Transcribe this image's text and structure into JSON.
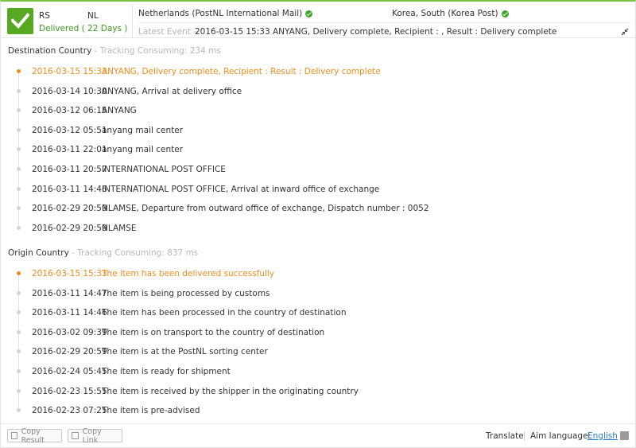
{
  "header": {
    "from_code": "RS",
    "to_code": "NL",
    "status": "Delivered ( 22 Days )",
    "from_carrier": "Netherlands (PostNL International Mail)",
    "to_carrier": "Korea, South (Korea Post)",
    "latest_label": "Latest Event --",
    "latest_text": "2016-03-15 15:33 ANYANG, Delivery complete, Recipient :               , Result : Delivery complete",
    "status_color": "#57a822",
    "icons": [
      "check-icon",
      "check-circle-icon",
      "collapse-icon"
    ]
  },
  "destination": {
    "title": "Destination Country",
    "consuming": " - Tracking Consuming: 234 ms",
    "events": [
      {
        "time": "2016-03-15 15:33",
        "desc": "ANYANG, Delivery complete, Recipient :               Result : Delivery complete"
      },
      {
        "time": "2016-03-14 10:30",
        "desc": "ANYANG, Arrival at delivery office"
      },
      {
        "time": "2016-03-12 06:15",
        "desc": "ANYANG"
      },
      {
        "time": "2016-03-12 05:51",
        "desc": "anyang mail center"
      },
      {
        "time": "2016-03-11 22:01",
        "desc": "anyang mail center"
      },
      {
        "time": "2016-03-11 20:57",
        "desc": "INTERNATIONAL POST OFFICE"
      },
      {
        "time": "2016-03-11 14:46",
        "desc": "INTERNATIONAL POST OFFICE, Arrival at inward office of exchange"
      },
      {
        "time": "2016-02-29 20:59",
        "desc": "NLAMSE, Departure from outward office of exchange, Dispatch number : 0052"
      },
      {
        "time": "2016-02-29 20:59",
        "desc": "NLAMSE"
      }
    ]
  },
  "origin": {
    "title": "Origin Country",
    "consuming": " - Tracking Consuming: 837 ms",
    "events": [
      {
        "time": "2016-03-15 15:33",
        "desc": "The item has been delivered successfully"
      },
      {
        "time": "2016-03-11 14:47",
        "desc": "The item is being processed by customs"
      },
      {
        "time": "2016-03-11 14:46",
        "desc": "The item has been processed in the country of destination"
      },
      {
        "time": "2016-03-02 09:39",
        "desc": "The item is on transport to the country of destination"
      },
      {
        "time": "2016-02-29 20:59",
        "desc": "The item is at the PostNL sorting center"
      },
      {
        "time": "2016-02-24 05:45",
        "desc": "The item is ready for shipment"
      },
      {
        "time": "2016-02-23 15:55",
        "desc": "The item is received by the shipper in the originating country"
      },
      {
        "time": "2016-02-23 07:25",
        "desc": "The item is pre-advised"
      }
    ]
  },
  "footer": {
    "copy_result": "Copy Result",
    "copy_link": "Copy Link",
    "translate": "Translate",
    "aim_language": "Aim language:",
    "language": "English"
  },
  "colors": {
    "latest": "#f08c1c",
    "link": "#2b7dd1",
    "accent": "#7cc142"
  }
}
